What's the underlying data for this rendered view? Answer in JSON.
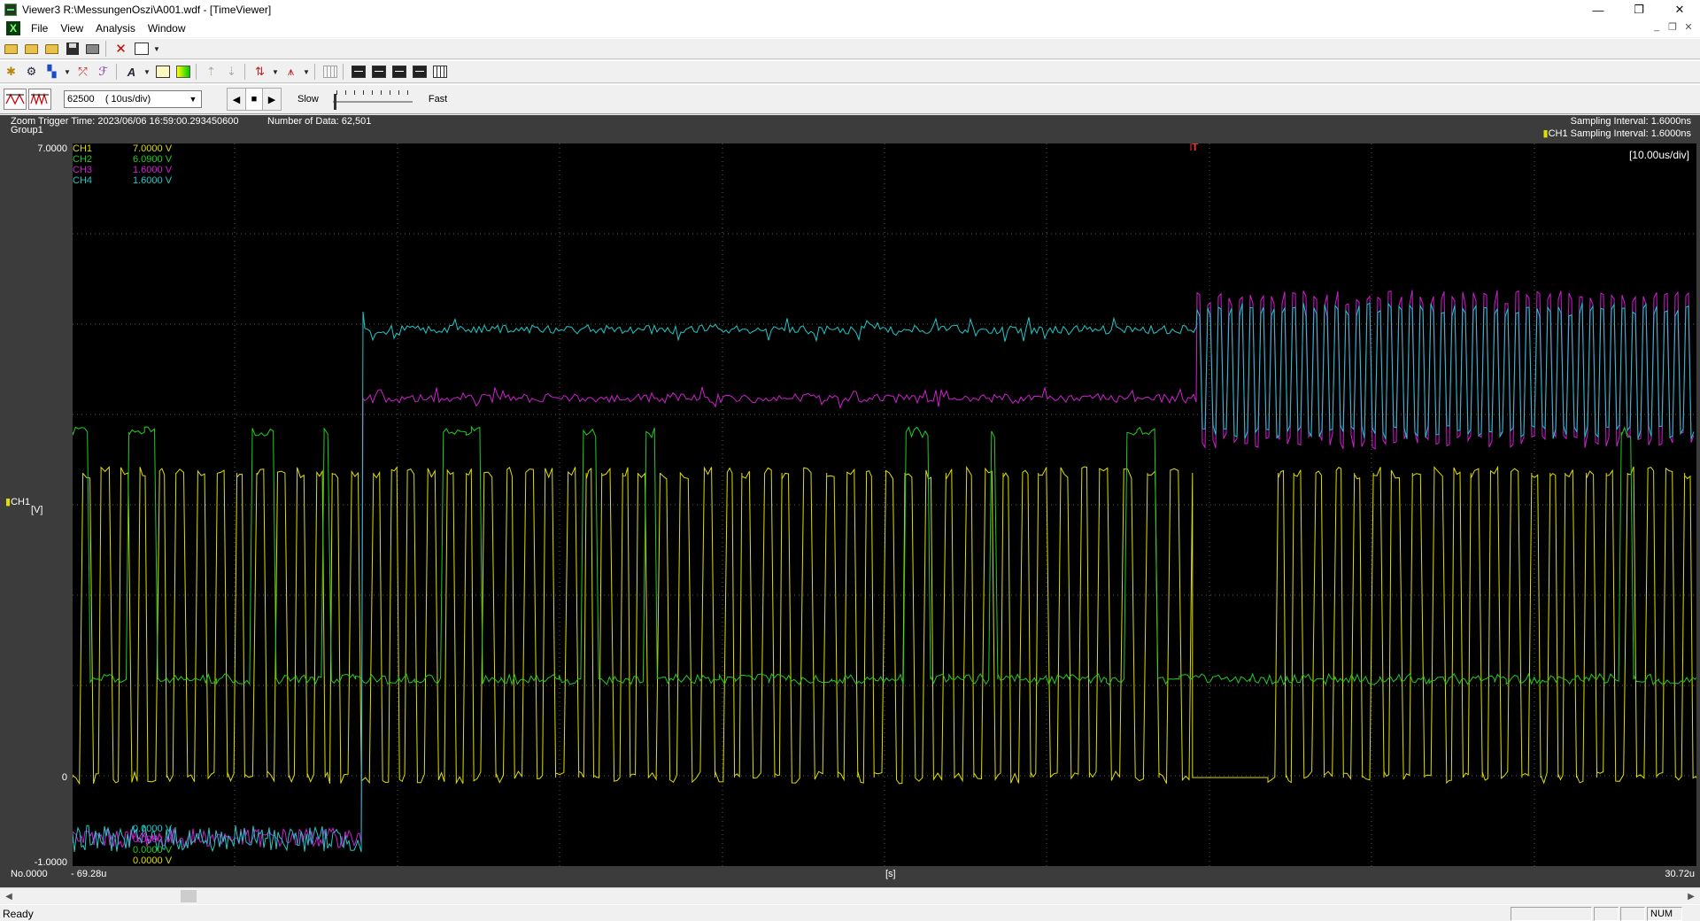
{
  "window": {
    "title": "Viewer3 R:\\MessungenOszi\\A001.wdf - [TimeViewer]",
    "minimize": "—",
    "maximize": "❐",
    "close": "✕"
  },
  "menu": {
    "items": [
      "File",
      "View",
      "Analysis",
      "Window"
    ]
  },
  "playback": {
    "zoom_value": "62500    ( 10us/div)",
    "slow_label": "Slow",
    "fast_label": "Fast"
  },
  "header": {
    "zoom_trigger_time": "Zoom Trigger Time: 2023/06/06 16:59:00.293450600",
    "number_of_data": "Number of Data: 62,501",
    "group": "Group1",
    "sampling_interval": "Sampling Interval:  1.6000ns",
    "ch1_sampling_interval": "CH1 Sampling Interval:  1.6000ns"
  },
  "plot": {
    "scale_label": "[10.00us/div]",
    "trigger_mark": "T",
    "y_top": "7.0000",
    "y_zero": "0",
    "y_bottom": "-1.0000",
    "axis_channel": "CH1",
    "axis_unit": "[V]",
    "x_start_label": "No.0000",
    "x_start_value": "- 69.28u",
    "x_unit": "[s]",
    "x_end_value": "30.72u"
  },
  "channels": [
    {
      "name": "CH1",
      "top": "7.0000 V",
      "bottom": "0.0000 V",
      "color": "#dede00"
    },
    {
      "name": "CH2",
      "top": "6.0900 V",
      "bottom": "0.0000 V",
      "color": "#22cc22"
    },
    {
      "name": "CH3",
      "top": "1.6000 V",
      "bottom": "0.0000 V",
      "color": "#d020d0"
    },
    {
      "name": "CH4",
      "top": "1.6000 V",
      "bottom": "0.0000 V",
      "color": "#20c8c8"
    }
  ],
  "status": {
    "text": "Ready",
    "num": "NUM"
  },
  "colors": {
    "plot_bg": "#000000",
    "grid": "#5a5a5a",
    "frame_bg": "#3c3c3c"
  }
}
